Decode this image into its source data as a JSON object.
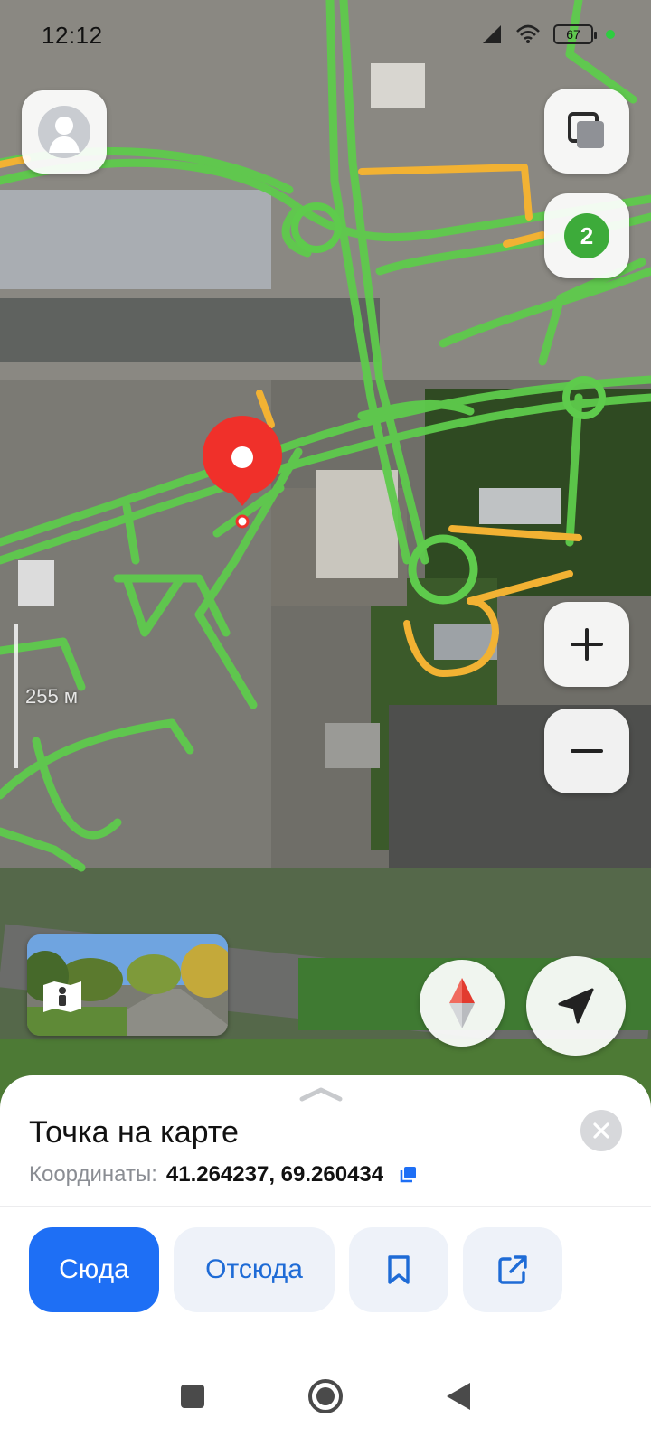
{
  "status_bar": {
    "time": "12:12",
    "battery": "67"
  },
  "map": {
    "scale_label": "255 м",
    "traffic_level": "2",
    "colors": {
      "road_free": "#5ecb4c",
      "road_slow": "#f2b233",
      "pin": "#f0302a"
    }
  },
  "icons": {
    "avatar": "user-avatar-icon",
    "layers": "layers-icon",
    "zoom_in": "plus-icon",
    "zoom_out": "minus-icon",
    "compass": "compass-icon",
    "locate": "navigation-arrow-icon",
    "panorama": "panorama-person-icon"
  },
  "sheet": {
    "title": "Точка на карте",
    "coords_label": "Координаты:",
    "coords_value": "41.264237, 69.260434",
    "actions": {
      "here": "Сюда",
      "from": "Отсюда"
    }
  },
  "accent_color": "#1e6ff5"
}
